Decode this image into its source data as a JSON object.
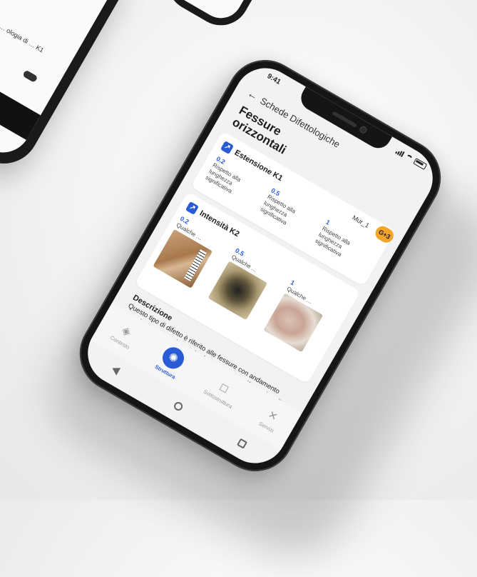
{
  "background_phone_left": {
    "text": "… ologia di … K1"
  },
  "status_bar": {
    "time": "9:41"
  },
  "header": {
    "back_label": "←",
    "title": "Schede Difettologiche"
  },
  "page_title": "Fessure orizzontali",
  "wall": {
    "label": "Mur_1",
    "badge": "G+3"
  },
  "k1": {
    "title": "Estensione K1",
    "options": [
      {
        "value": "0.2",
        "desc": "Rispetto alla lunghezza significativa"
      },
      {
        "value": "0.5",
        "desc": "Rispetto alla lunghezza significativa"
      },
      {
        "value": "1",
        "desc": "Rispetto alla lunghezza significativa"
      }
    ]
  },
  "k2": {
    "title": "Intensità K2",
    "options": [
      {
        "value": "0.2",
        "desc": "Qualche …"
      },
      {
        "value": "0.5",
        "desc": "Qualche …"
      },
      {
        "value": "1",
        "desc": "Qualche …"
      }
    ]
  },
  "description": {
    "title": "Descrizione",
    "text": "Questo tipo di difetto è riferito alle fessure con andamento prevalentemente orizzontale che possono manifestarsi sugli elementi verticali come spalle e pile e, nel caso dei ponti ad arco, su rinfianchi e timpani. Esse si sviluppano principalmente lungo i ricorsi di malta o, meno frequentemente, attraversano direttamente i mattoni o i blocchi di pietra."
  },
  "tabs": [
    {
      "label": "Contesto",
      "icon": "layers-icon",
      "active": false
    },
    {
      "label": "Struttura",
      "icon": "structure-icon",
      "active": true
    },
    {
      "label": "Sottostruttura",
      "icon": "substructure-icon",
      "active": false
    },
    {
      "label": "Servizi",
      "icon": "tools-icon",
      "active": false
    }
  ]
}
